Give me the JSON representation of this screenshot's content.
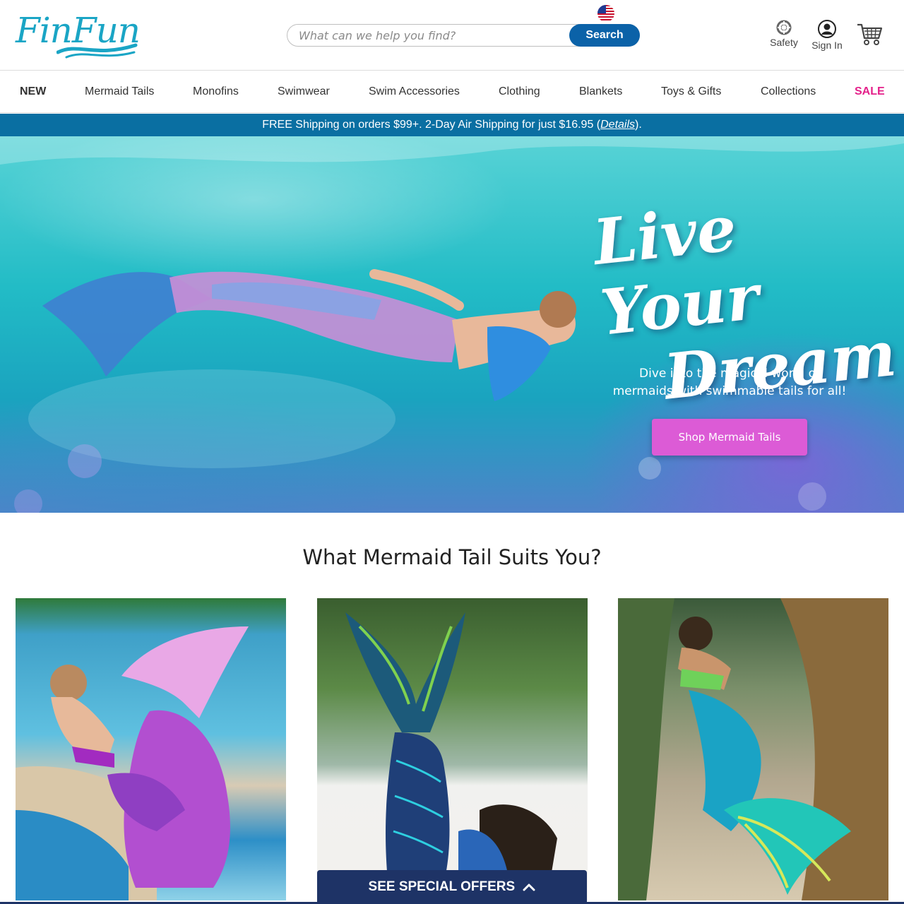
{
  "header": {
    "logo_text": "FinFun",
    "search_placeholder": "What can we help you find?",
    "search_button": "Search",
    "safety_label": "Safety",
    "signin_label": "Sign In",
    "icons": [
      "us-flag-icon",
      "safety-ring-icon",
      "user-icon",
      "cart-icon"
    ]
  },
  "nav": {
    "items": [
      "NEW",
      "Mermaid Tails",
      "Monofins",
      "Swimwear",
      "Swim Accessories",
      "Clothing",
      "Blankets",
      "Toys & Gifts",
      "Collections",
      "SALE"
    ]
  },
  "shipping_bar": {
    "text_before": "FREE Shipping on orders $99+. 2-Day Air Shipping for just $16.95 (",
    "link": "Details",
    "text_after": ")."
  },
  "hero": {
    "title_line1": "Live Your",
    "title_line2": "Dream",
    "subtitle": "Dive into the magical world of mermaids with swimmable tails for all!",
    "cta": "Shop Mermaid Tails"
  },
  "section": {
    "title": "What Mermaid Tail Suits You?"
  },
  "offers_button": "SEE SPECIAL OFFERS",
  "colors": {
    "brand_blue": "#0b62a8",
    "ship_bar": "#0a6fa2",
    "sale_pink": "#e4208a",
    "cta_pink": "#dc5bd6",
    "offers_navy": "#1e3366"
  }
}
